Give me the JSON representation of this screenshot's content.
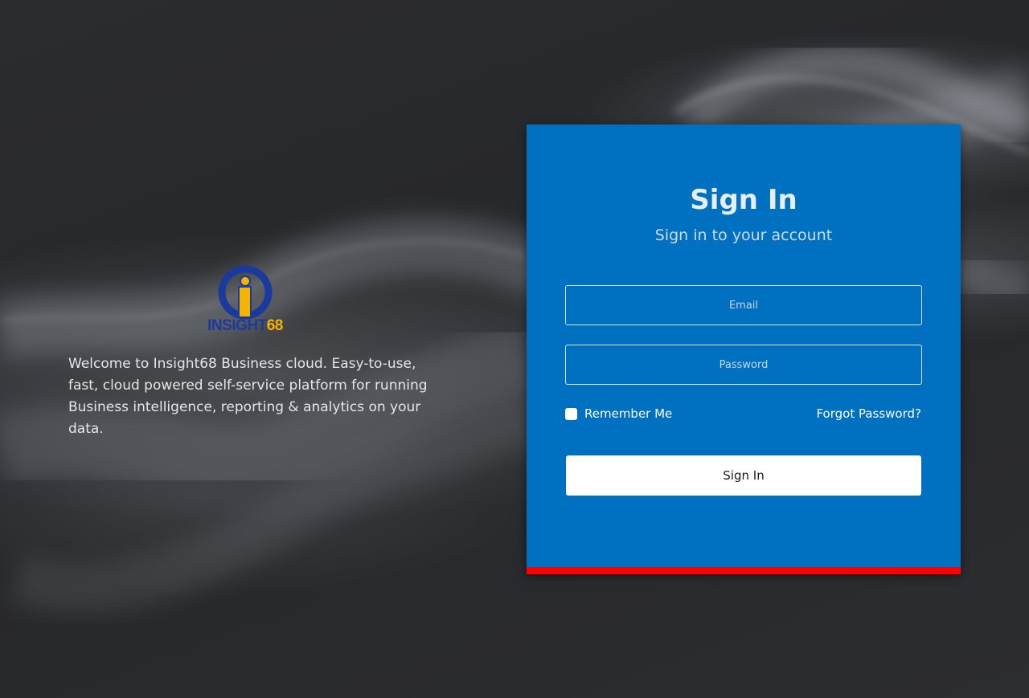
{
  "brand": {
    "logo_text_a": "INSIGHT",
    "logo_text_b": "68",
    "welcome": "Welcome to Insight68 Business cloud. Easy-to-use, fast, cloud powered self-service platform for running Business intelligence, reporting & analytics on your data."
  },
  "signin": {
    "title": "Sign In",
    "subtitle": "Sign in to your account",
    "email_placeholder": "Email",
    "email_value": "",
    "password_placeholder": "Password",
    "password_value": "",
    "remember_label": "Remember Me",
    "remember_checked": false,
    "forgot_label": "Forgot Password?",
    "button_label": "Sign In"
  },
  "colors": {
    "card_background": "#0070c0",
    "card_accent_bar": "#ff0000",
    "logo_blue": "#1b3a9e",
    "logo_yellow": "#f4b400",
    "page_background": "#2a2b2e"
  }
}
